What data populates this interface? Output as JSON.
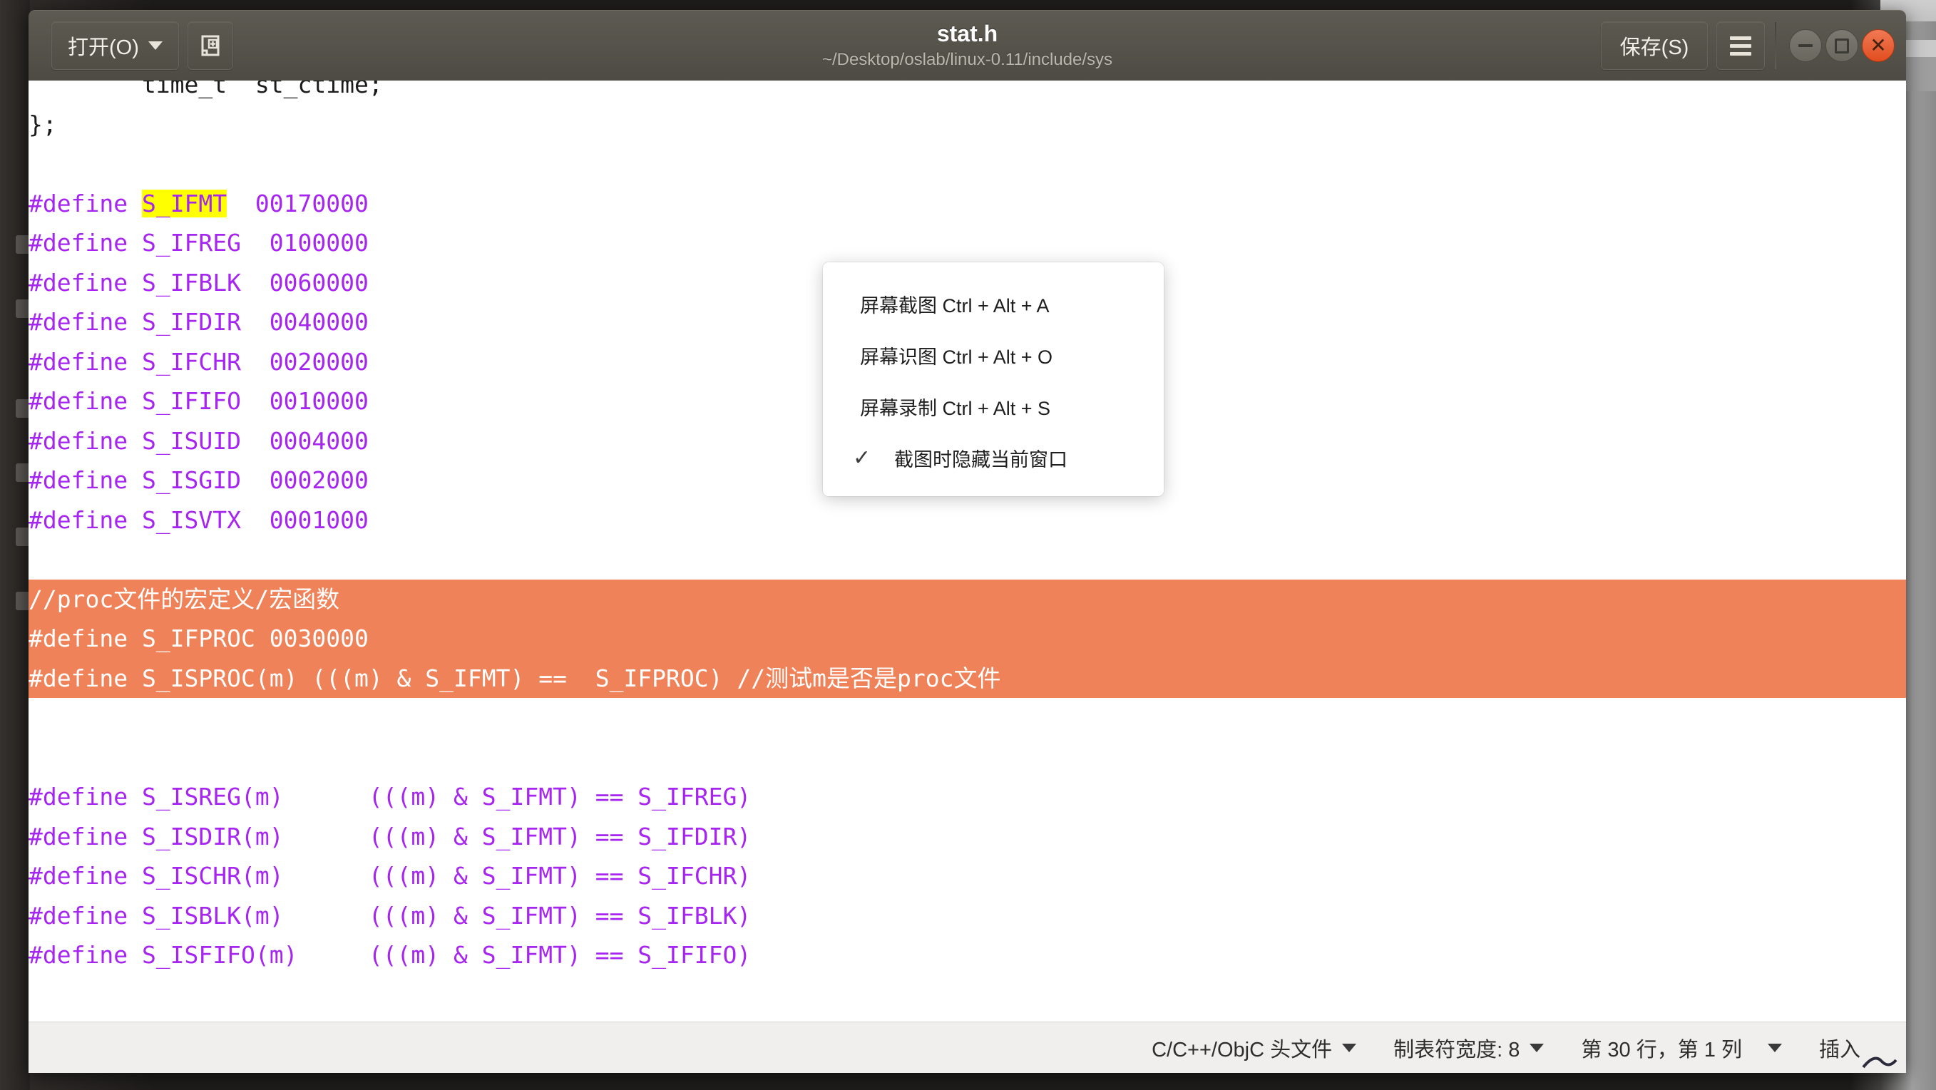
{
  "window": {
    "title": "stat.h",
    "subtitle": "~/Desktop/oslab/linux-0.11/include/sys"
  },
  "headerbar": {
    "open_label": "打开(O)",
    "newtab_icon": "new-tab-icon",
    "save_label": "保存(S)",
    "menu_icon": "hamburger-icon",
    "minimize_icon": "minimize-icon",
    "maximize_icon": "maximize-icon",
    "close_icon": "close-icon",
    "close_glyph": "✕"
  },
  "popup_menu": {
    "items": [
      {
        "label": "屏幕截图 Ctrl + Alt + A",
        "checked": false
      },
      {
        "label": "屏幕识图 Ctrl + Alt + O",
        "checked": false
      },
      {
        "label": "屏幕录制 Ctrl + Alt + S",
        "checked": false
      },
      {
        "label": "截图时隐藏当前窗口",
        "checked": true,
        "check_glyph": "✓"
      }
    ]
  },
  "editor": {
    "lines": [
      {
        "segments": [
          {
            "text": "        time_t  st_ctime;",
            "style": "plain"
          }
        ]
      },
      {
        "segments": [
          {
            "text": "};",
            "style": "plain"
          }
        ]
      },
      {
        "segments": [
          {
            "text": "",
            "style": "plain"
          }
        ]
      },
      {
        "segments": [
          {
            "text": "#define ",
            "style": "kw"
          },
          {
            "text": "S_IFMT",
            "style": "hl-yellow"
          },
          {
            "text": "  00170000",
            "style": "kw"
          }
        ]
      },
      {
        "segments": [
          {
            "text": "#define S_IFREG  0100000",
            "style": "kw"
          }
        ]
      },
      {
        "segments": [
          {
            "text": "#define S_IFBLK  0060000",
            "style": "kw"
          }
        ]
      },
      {
        "segments": [
          {
            "text": "#define S_IFDIR  0040000",
            "style": "kw"
          }
        ]
      },
      {
        "segments": [
          {
            "text": "#define S_IFCHR  0020000",
            "style": "kw"
          }
        ]
      },
      {
        "segments": [
          {
            "text": "#define S_IFIFO  0010000",
            "style": "kw"
          }
        ]
      },
      {
        "segments": [
          {
            "text": "#define S_ISUID  0004000",
            "style": "kw"
          }
        ]
      },
      {
        "segments": [
          {
            "text": "#define S_ISGID  0002000",
            "style": "kw"
          }
        ]
      },
      {
        "segments": [
          {
            "text": "#define S_ISVTX  0001000",
            "style": "kw"
          }
        ]
      },
      {
        "segments": [
          {
            "text": "",
            "style": "plain"
          }
        ]
      },
      {
        "segments": [
          {
            "text": "//proc文件的宏定义/宏函数",
            "style": "sel"
          }
        ]
      },
      {
        "segments": [
          {
            "text": "#define S_IFPROC 0030000",
            "style": "sel"
          }
        ]
      },
      {
        "segments": [
          {
            "text": "#define S_ISPROC(m) (((m) & S_IFMT) ==  S_IFPROC) //测试m是否是proc文件",
            "style": "sel"
          }
        ]
      },
      {
        "segments": [
          {
            "text": "",
            "style": "plain"
          }
        ]
      },
      {
        "segments": [
          {
            "text": "",
            "style": "plain"
          }
        ]
      },
      {
        "segments": [
          {
            "text": "#define S_ISREG(m)      (((m) & S_IFMT) == S_IFREG)",
            "style": "kw"
          }
        ]
      },
      {
        "segments": [
          {
            "text": "#define S_ISDIR(m)      (((m) & S_IFMT) == S_IFDIR)",
            "style": "kw"
          }
        ]
      },
      {
        "segments": [
          {
            "text": "#define S_ISCHR(m)      (((m) & S_IFMT) == S_IFCHR)",
            "style": "kw"
          }
        ]
      },
      {
        "segments": [
          {
            "text": "#define S_ISBLK(m)      (((m) & S_IFMT) == S_IFBLK)",
            "style": "kw"
          }
        ]
      },
      {
        "segments": [
          {
            "text": "#define S_ISFIFO(m)     (((m) & S_IFMT) == S_IFIFO)",
            "style": "kw"
          }
        ]
      }
    ]
  },
  "statusbar": {
    "language": "C/C++/ObjC 头文件",
    "tab_width": "制表符宽度: 8",
    "position": "第 30 行，第 1 列",
    "mode": "插入"
  },
  "colors": {
    "selection_orange": "#ef8258",
    "keyword_purple": "#a625f0",
    "highlight_yellow": "#ffff00",
    "headerbar": "#55524a",
    "statusbar": "#f0efed",
    "close_button": "#e24d1f"
  }
}
